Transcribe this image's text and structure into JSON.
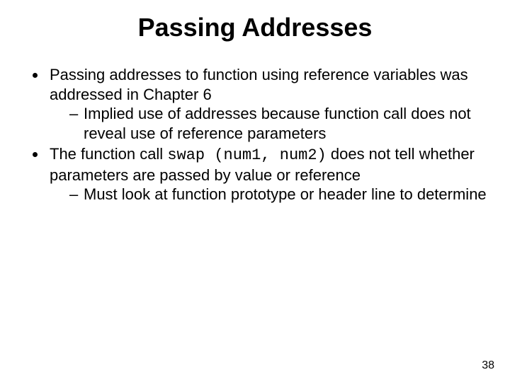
{
  "title": "Passing Addresses",
  "bullets": {
    "b1": "Passing addresses to function using reference variables was addressed in Chapter 6",
    "b1_sub1": "Implied use of addresses because function call does not reveal use of reference parameters",
    "b2_pre": "The function call ",
    "b2_code": "swap (num1, num2)",
    "b2_post": " does not tell whether parameters are passed by value or reference",
    "b2_sub1": "Must look at function prototype or header line to determine"
  },
  "page_number": "38"
}
